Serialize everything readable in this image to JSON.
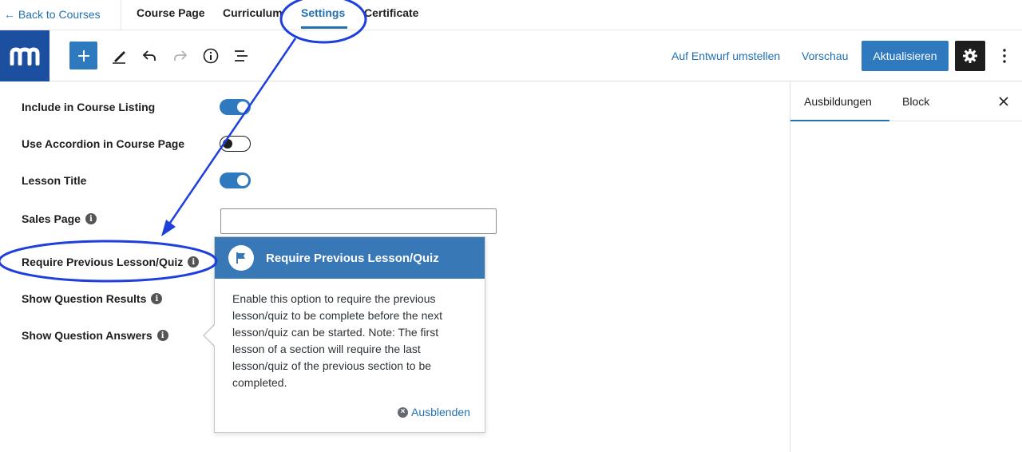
{
  "course_tabs": {
    "back_label": "← Back to Courses",
    "items": [
      {
        "label": "Course Page"
      },
      {
        "label": "Curriculum"
      },
      {
        "label": "Settings"
      },
      {
        "label": "Certificate"
      }
    ],
    "active": "Settings"
  },
  "editor_toolbar": {
    "icons": [
      "logo-m-icon",
      "plus-icon",
      "pencil-icon",
      "undo-icon",
      "redo-icon",
      "info-icon",
      "list-view-icon",
      "gear-icon",
      "more-vertical-icon"
    ],
    "switch_to_draft_label": "Auf Entwurf umstellen",
    "preview_label": "Vorschau",
    "update_label": "Aktualisieren"
  },
  "sidebar": {
    "tabs": [
      {
        "label": "Ausbildungen"
      },
      {
        "label": "Block"
      }
    ],
    "active_tab": "Ausbildungen"
  },
  "settings": {
    "include_in_listing": {
      "label": "Include in Course Listing",
      "enabled": true
    },
    "use_accordion": {
      "label": "Use Accordion in Course Page",
      "enabled": false
    },
    "lesson_title": {
      "label": "Lesson Title",
      "enabled": true
    },
    "sales_page": {
      "label": "Sales Page",
      "value": ""
    },
    "require_previous": {
      "label": "Require Previous Lesson/Quiz"
    },
    "show_results": {
      "label": "Show Question Results"
    },
    "show_answers": {
      "label": "Show Question Answers"
    }
  },
  "popover": {
    "title": "Require Previous Lesson/Quiz",
    "body": "Enable this option to require the previous lesson/quiz to be complete before the next lesson/quiz can be started. Note: The first lesson of a section will require the last lesson/quiz of the previous section to be completed.",
    "dismiss_label": "Ausblenden"
  },
  "colors": {
    "accent": "#2271b1",
    "button_blue": "#2f79be",
    "logo_blue": "#1d4fa0",
    "popover_header": "#3878b6",
    "annotation_blue": "#1f3fdc"
  }
}
